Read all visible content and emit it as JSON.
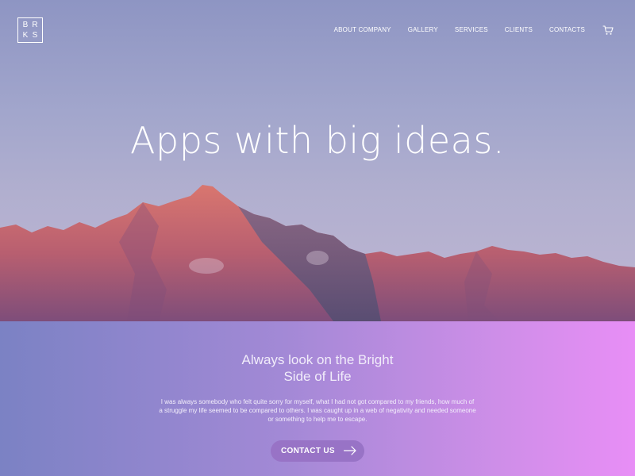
{
  "logo": {
    "letters": [
      "B",
      "R",
      "K",
      "S"
    ]
  },
  "nav": {
    "items": [
      {
        "label": "ABOUT COMPANY"
      },
      {
        "label": "GALLERY"
      },
      {
        "label": "SERVICES"
      },
      {
        "label": "CLIENTS"
      },
      {
        "label": "CONTACTS"
      }
    ],
    "cart_icon": "cart-icon"
  },
  "hero": {
    "headline": "Apps with big ideas."
  },
  "section": {
    "subhead_line1": "Always look on the Bright",
    "subhead_line2": "Side of Life",
    "body": "I was always somebody who felt quite sorry for myself, what I had not got compared to my friends, how much of a struggle my life seemed to be compared to others. I was caught up in a web of negativity and needed someone or something to help me to escape.",
    "cta_label": "CONTACT US",
    "cta_icon": "arrow-right-icon"
  },
  "colors": {
    "gradient_start": "#7b82c4",
    "gradient_end": "#e88ef6",
    "button": "#9873c6"
  }
}
